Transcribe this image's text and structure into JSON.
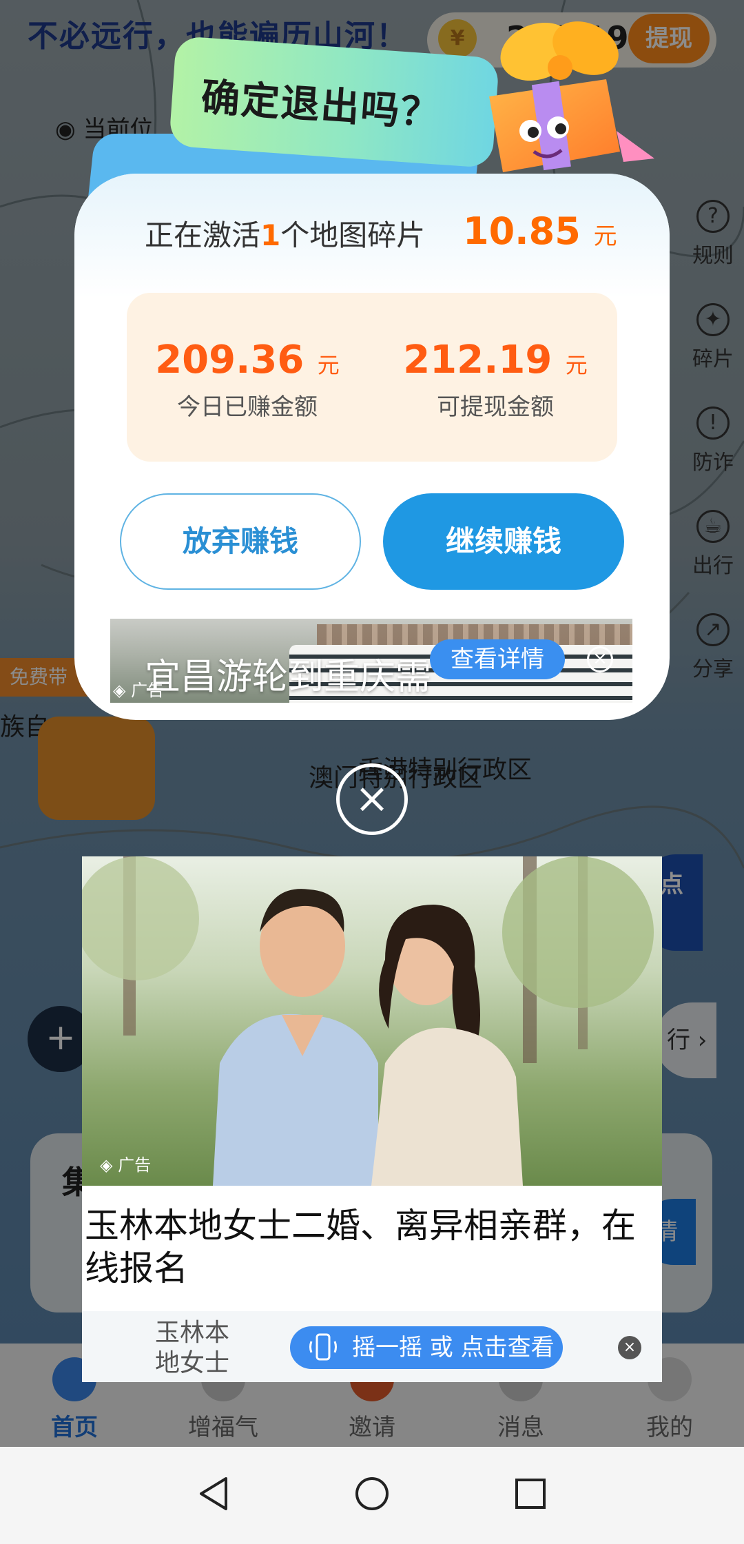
{
  "background_app": {
    "slogan": "不必远行，也能遍历山河！",
    "balance": "212.19",
    "coin_icon": "¥",
    "withdraw": "提现",
    "location": "当前位",
    "side_items": [
      "规则",
      "碎片",
      "防诈",
      "出行",
      "分享"
    ],
    "free_badge": "免费带",
    "ethnic_label": "族自",
    "place_macau": "澳门特别行政区",
    "place_hk": "香港特别行政区",
    "zoom_icon": "+",
    "card_title": "集",
    "card_button": "情",
    "right_pill": "行 ›",
    "blue_badge": "点 \n"
  },
  "tabbar": {
    "tabs": [
      {
        "label": "首页",
        "active": true
      },
      {
        "label": "增福气",
        "active": false
      },
      {
        "label": "邀请",
        "active": false
      },
      {
        "label": "消息",
        "active": false
      },
      {
        "label": "我的",
        "active": false
      }
    ]
  },
  "dialog": {
    "title": "确定退出吗？",
    "activating_prefix": "正在激活",
    "activating_count": "1",
    "activating_suffix": "个地图碎片",
    "fragment_value": "10.85",
    "unit": "元",
    "today_earned": "209.36",
    "today_earned_label": "今日已赚金额",
    "withdrawable": "212.19",
    "withdrawable_label": "可提现金额",
    "quit_label": "放弃赚钱",
    "continue_label": "继续赚钱",
    "ad": {
      "title": "宜昌游轮到重庆需",
      "tag": "广告",
      "detail_label": "查看详情",
      "close_glyph": "×"
    }
  },
  "overlay_close_glyph": "×",
  "bottom_ad": {
    "tag": "广告",
    "title": "玉林本地女士二婚、离异相亲群，在线报名",
    "brand": "玉林本地女士二",
    "shake_label": "摇一摇 或 点击查看",
    "close_glyph": "×"
  },
  "colors": {
    "accent_orange": "#ff6a00",
    "primary_blue": "#1f98e3",
    "earn_box_bg": "#fef2e3"
  }
}
